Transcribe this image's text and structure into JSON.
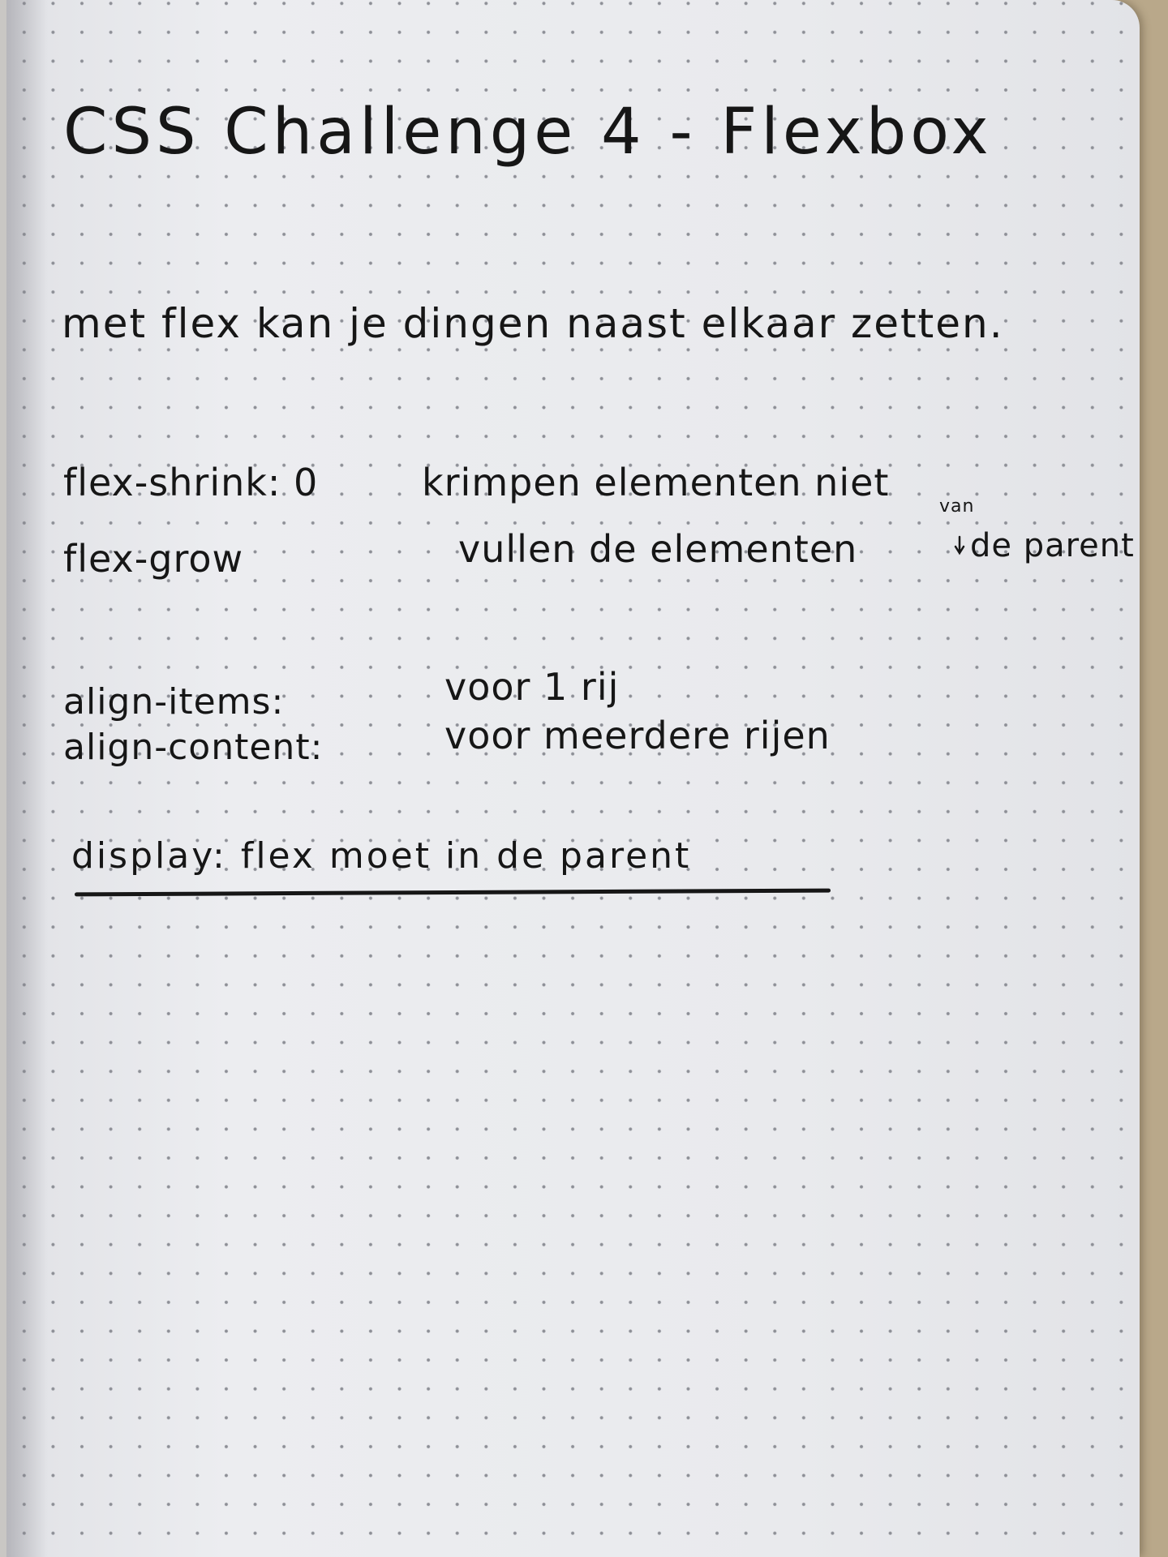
{
  "notebook": {
    "title": "CSS Challenge 4 - Flexbox",
    "intro": "met flex kan je dingen naast elkaar zetten.",
    "properties": [
      {
        "term": "flex-shrink: 0",
        "description": "krimpen elementen niet"
      },
      {
        "term": "flex-grow",
        "description": "vullen de elementen",
        "insertion": "van",
        "description_end": "de parent"
      },
      {
        "term": "align-items:",
        "description": "voor 1 rij"
      },
      {
        "term": "align-content:",
        "description": "voor meerdere rijen"
      }
    ],
    "rule": "display: flex moet in de parent"
  },
  "colors": {
    "paper": "#e9eaee",
    "ink": "#161616",
    "dot_grid": "#8d8f96",
    "background": "#b9a88a"
  }
}
